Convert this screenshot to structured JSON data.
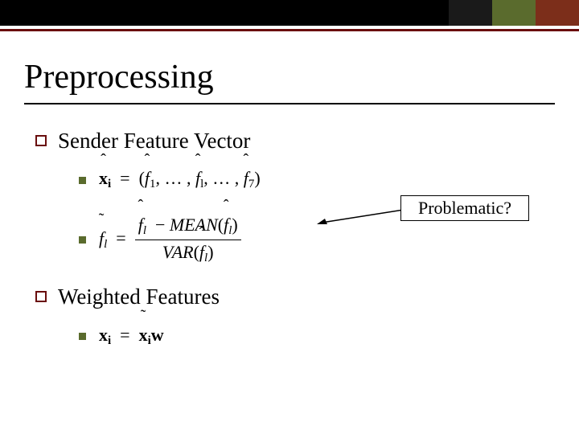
{
  "title": "Preprocessing",
  "sections": [
    {
      "label": "Sender Feature Vector",
      "items": [
        {
          "kind": "eq_vector",
          "lhs_var": "x",
          "lhs_sub": "i",
          "components_var": "f",
          "first_index": "1",
          "mid_index": "l",
          "last_index": "7"
        },
        {
          "kind": "eq_standardize",
          "lhs_var": "f",
          "lhs_sub": "l",
          "num_mean_op": "MEAN",
          "den_var_op": "VAR",
          "arg_var": "f",
          "arg_sub": "l"
        }
      ]
    },
    {
      "label": "Weighted Features",
      "items": [
        {
          "kind": "eq_weighted",
          "lhs_var": "x",
          "lhs_sub": "i",
          "rhs_x_var": "x",
          "rhs_x_sub": "i",
          "rhs_w": "w"
        }
      ]
    }
  ],
  "callout": {
    "text": "Problematic?"
  },
  "colors": {
    "maroon": "#6a0e0e",
    "olive": "#5a6b2d"
  }
}
